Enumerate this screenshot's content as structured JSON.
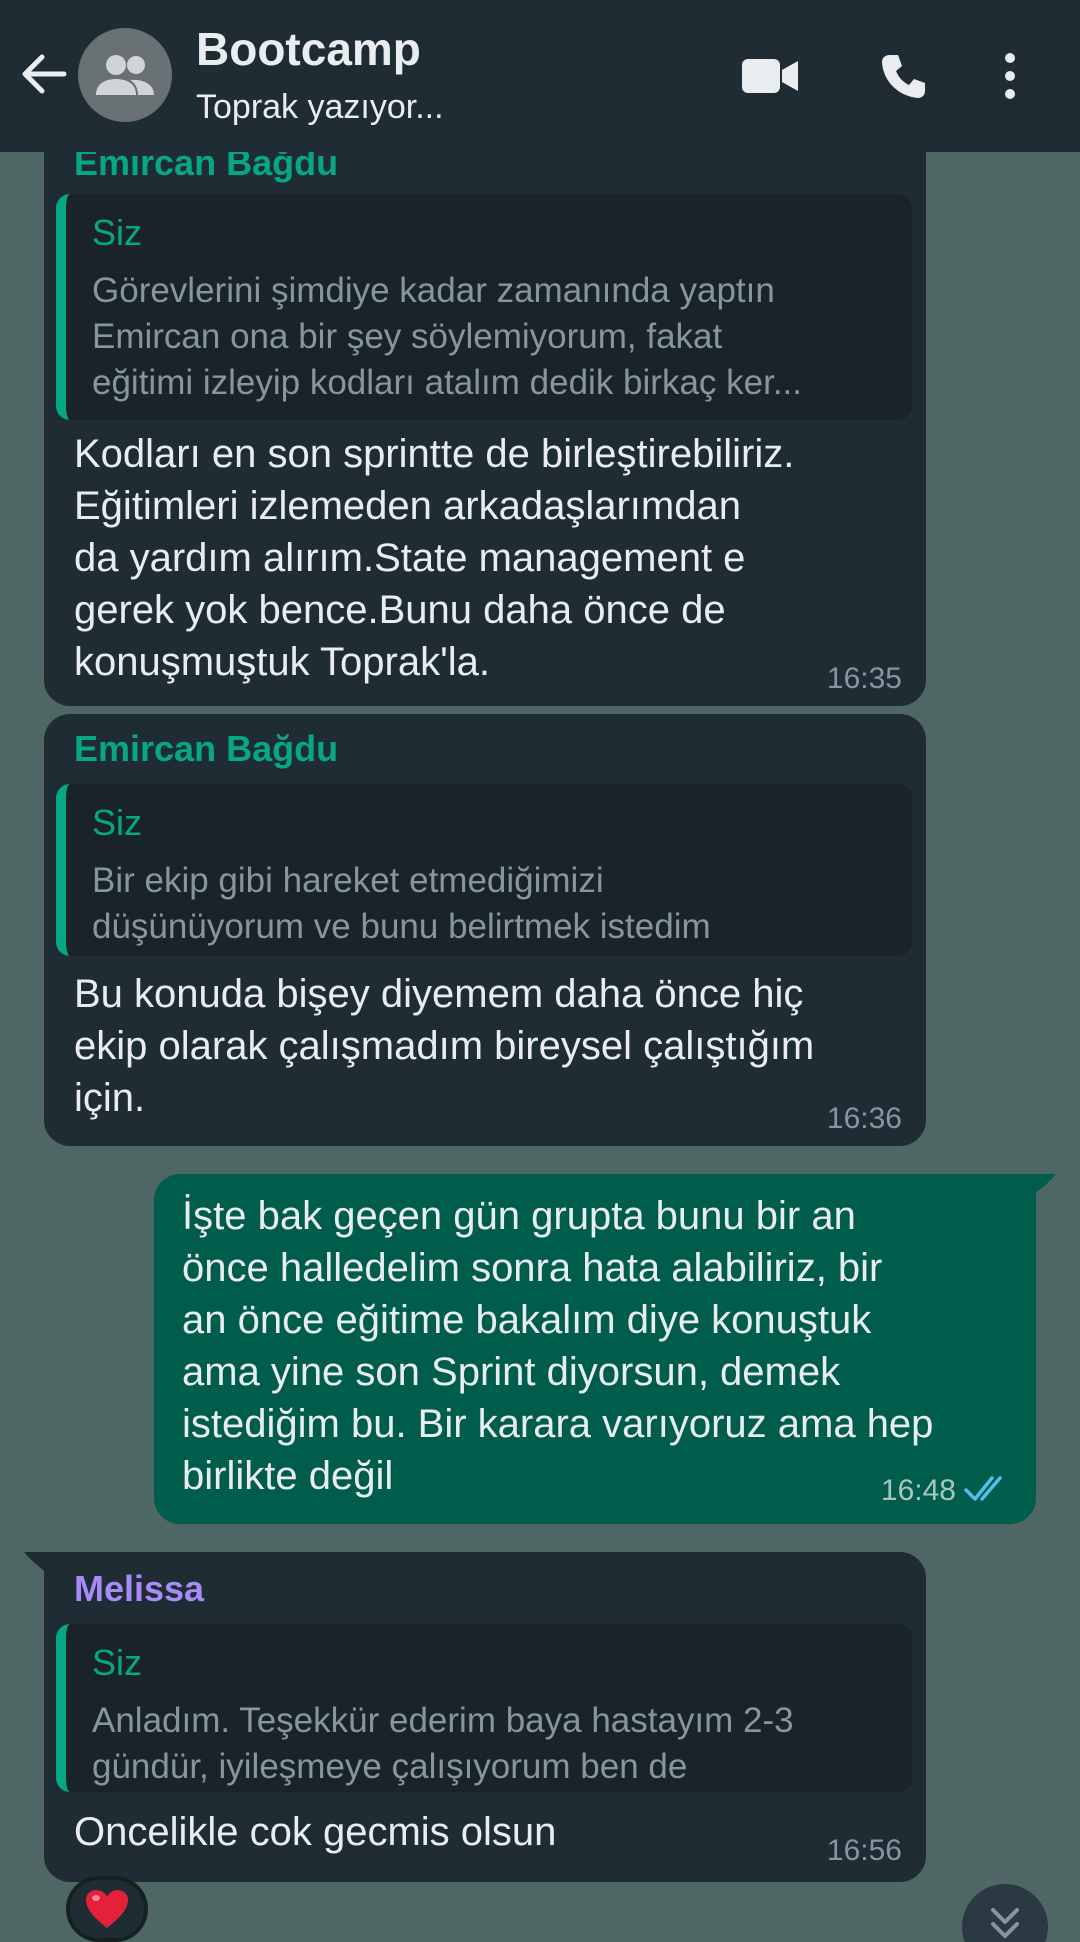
{
  "header": {
    "title": "Bootcamp",
    "subtitle": "Toprak yazıyor..."
  },
  "colors": {
    "header_bg": "#1f2c34",
    "chat_bg": "#4f6764",
    "incoming_bubble": "#202c33",
    "outgoing_bubble": "#005c4b",
    "quote_accent": "#06a884",
    "sender_emircan": "#06a884",
    "sender_melissa": "#a78bfa",
    "read_ticks": "#53bdeb"
  },
  "messages": [
    {
      "sender": "Emircan Bağdu",
      "quote_sender": "Siz",
      "quote_text": "Görevlerini şimdiye kadar zamanında yaptın\nEmircan ona bir şey söylemiyorum, fakat\neğitimi izleyip kodları atalım dedik birkaç ker...",
      "text": "Kodları en son sprintte de birleştirebiliriz.\nEğitimleri izlemeden arkadaşlarımdan\nda yardım alırım.State management e\ngerek yok bence.Bunu daha önce de\nkonuşmuştuk Toprak'la.",
      "time": "16:35"
    },
    {
      "sender": "Emircan Bağdu",
      "quote_sender": "Siz",
      "quote_text": "Bir ekip gibi hareket etmediğimizi\ndüşünüyorum ve bunu belirtmek istedim",
      "text": "Bu konuda bişey diyemem daha önce hiç\nekip olarak çalışmadım bireysel çalıştığım\niçin.",
      "time": "16:36"
    },
    {
      "text": "İşte bak geçen gün grupta bunu bir an\nönce halledelim sonra hata alabiliriz, bir\nan önce eğitime bakalım diye konuştuk\nama yine son Sprint diyorsun, demek\nistediğim bu. Bir karara varıyoruz ama hep\nbirlikte değil",
      "time": "16:48",
      "status": "read-ticks-icon"
    },
    {
      "sender": "Melissa",
      "quote_sender": "Siz",
      "quote_text": "Anladım. Teşekkür ederim baya hastayım 2-3\ngündür, iyileşmeye çalışıyorum ben de",
      "text": "Oncelikle cok gecmis olsun",
      "time": "16:56",
      "reaction": "heart-emoji"
    }
  ]
}
